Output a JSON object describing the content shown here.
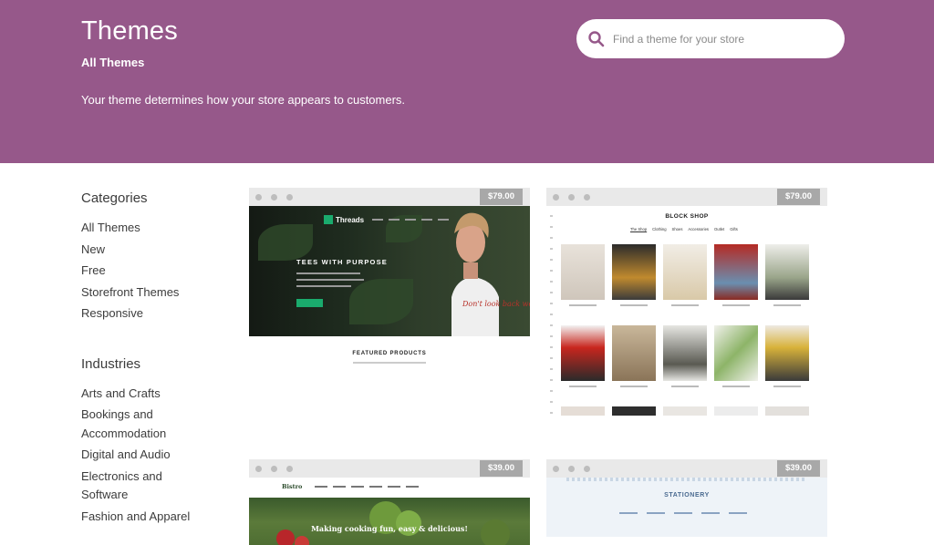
{
  "header": {
    "title": "Themes",
    "subtitle": "All Themes",
    "description": "Your theme determines how your store appears to customers.",
    "search_placeholder": "Find a theme for your store"
  },
  "sidebar": {
    "categories_heading": "Categories",
    "categories": [
      "All Themes",
      "New",
      "Free",
      "Storefront Themes",
      "Responsive"
    ],
    "industries_heading": "Industries",
    "industries": [
      "Arts and Crafts",
      "Bookings and",
      "Accommodation",
      "Digital and Audio",
      "Electronics and",
      "Software",
      "Fashion and Apparel"
    ]
  },
  "cards": [
    {
      "price": "$79.00",
      "logo": "Threads",
      "tagline": "TEES WITH PURPOSE",
      "shirt_text": "Don't look back we're not going that way",
      "section_heading": "FEATURED PRODUCTS"
    },
    {
      "price": "$79.00",
      "title": "BLOCK SHOP",
      "nav": [
        "The Shop",
        "Clothing",
        "Shoes",
        "Accessories",
        "Outlet",
        "Gifts"
      ]
    },
    {
      "price": "$39.00",
      "logo": "Bistro",
      "tagline": "Making cooking fun, easy & delicious!"
    },
    {
      "price": "$39.00",
      "title": "STATIONERY"
    }
  ],
  "colors": {
    "brand": "#96588a",
    "accent_green": "#1aab6d",
    "price_badge": "#a8a8a8"
  }
}
